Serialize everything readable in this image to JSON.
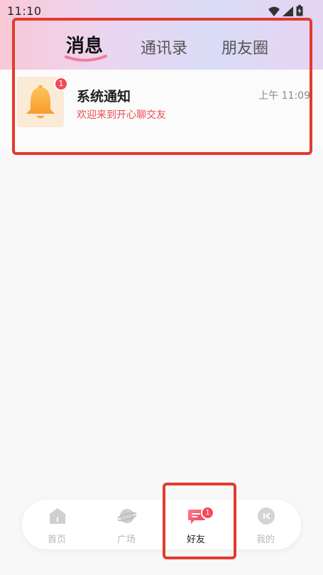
{
  "status_bar": {
    "time": "11:10"
  },
  "tabs": [
    {
      "label": "消息",
      "active": true
    },
    {
      "label": "通讯录",
      "active": false
    },
    {
      "label": "朋友圈",
      "active": false
    }
  ],
  "messages": [
    {
      "title": "系统通知",
      "subtitle": "欢迎来到开心聊交友",
      "time": "上午 11:09",
      "badge": "1",
      "icon": "bell-icon"
    }
  ],
  "bottom_nav": {
    "items": [
      {
        "label": "首页",
        "icon": "home-icon",
        "active": false
      },
      {
        "label": "广场",
        "icon": "planet-icon",
        "active": false
      },
      {
        "label": "好友",
        "icon": "chat-bubble-icon",
        "active": true,
        "badge": "1"
      },
      {
        "label": "我的",
        "icon": "profile-icon",
        "active": false
      }
    ]
  },
  "colors": {
    "accent": "#f24a5a",
    "highlight_box": "#e23b2e",
    "subtitle_red": "#ef4b55",
    "bell_orange": "#fbb03b"
  }
}
